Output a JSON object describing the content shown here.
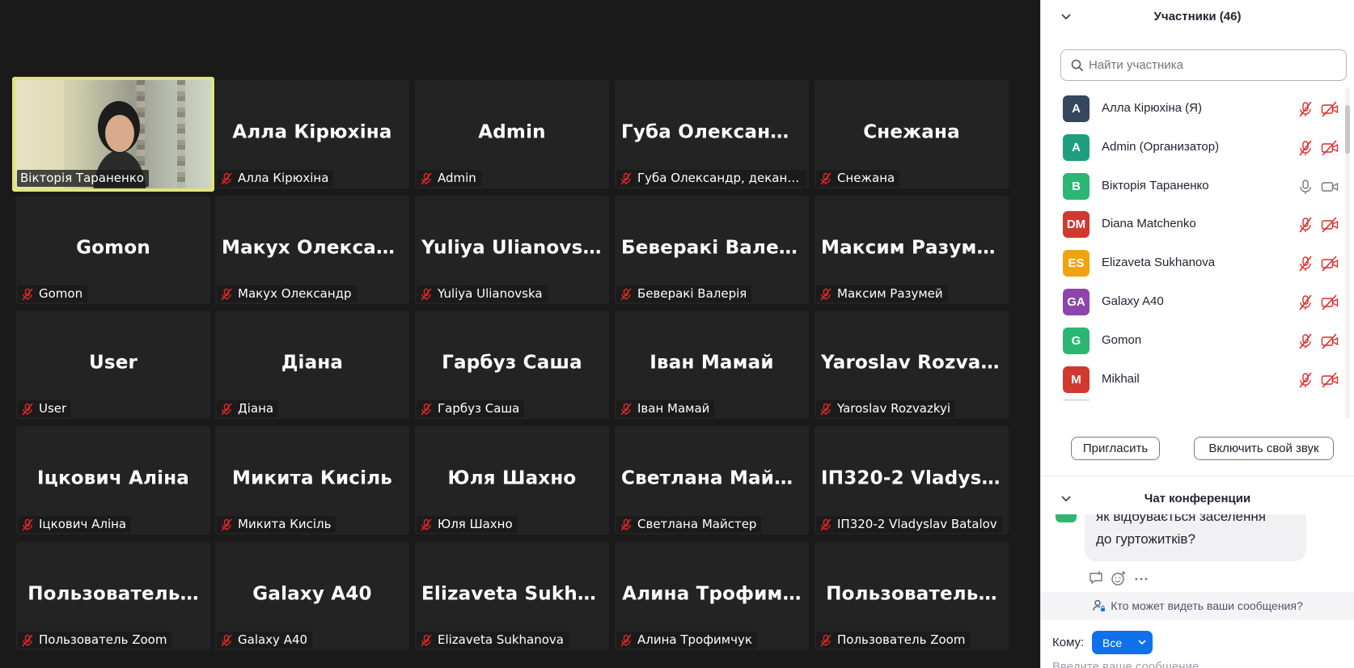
{
  "grid": {
    "tiles": [
      {
        "big": "",
        "label": "Вікторія Тараненко",
        "speaker": true,
        "video": true
      },
      {
        "big": "Алла Кірюхіна",
        "label": "Алла Кірюхіна"
      },
      {
        "big": "Admin",
        "label": "Admin"
      },
      {
        "big": "Губа  Олександ…",
        "label": "Губа Олександр, декан фак…"
      },
      {
        "big": "Снежана",
        "label": "Снежана"
      },
      {
        "big": "Gomon",
        "label": "Gomon"
      },
      {
        "big": "Макух  Олексан…",
        "label": "Макух Олександр"
      },
      {
        "big": "Yuliya Ulianovska",
        "label": "Yuliya Ulianovska"
      },
      {
        "big": "Беверакі Валерія",
        "label": "Беверакі Валерія"
      },
      {
        "big": "Максим Разумей",
        "label": "Максим Разумей"
      },
      {
        "big": "User",
        "label": "User"
      },
      {
        "big": "Діана",
        "label": "Діана"
      },
      {
        "big": "Гарбуз Саша",
        "label": "Гарбуз Саша"
      },
      {
        "big": "Іван Мамай",
        "label": "Іван Мамай"
      },
      {
        "big": "Yaroslav  Rozvaz…",
        "label": "Yaroslav Rozvazkyi"
      },
      {
        "big": "Іцкович Аліна",
        "label": "Іцкович Аліна"
      },
      {
        "big": "Микита Кисіль",
        "label": "Микита Кисіль"
      },
      {
        "big": "Юля Шахно",
        "label": "Юля Шахно"
      },
      {
        "big": "Светлана  Майс…",
        "label": "Светлана Майстер"
      },
      {
        "big": "ІП320-2  Vladysl…",
        "label": "ІП320-2 Vladyslav Batalov"
      },
      {
        "big": "Пользователь…",
        "label": "Пользователь Zoom"
      },
      {
        "big": "Galaxy A40",
        "label": "Galaxy A40"
      },
      {
        "big": "Elizaveta  Sukha…",
        "label": "Elizaveta Sukhanova"
      },
      {
        "big": "Алина  Трофим…",
        "label": "Алина Трофимчук"
      },
      {
        "big": "Пользователь…",
        "label": "Пользователь Zoom"
      }
    ]
  },
  "participants": {
    "title": "Участники (46)",
    "search_placeholder": "Найти участника",
    "list": [
      {
        "initials": "А",
        "name": "Алла Кірюхіна (Я)",
        "color": "#36465d",
        "muted": true,
        "cam_off": true
      },
      {
        "initials": "A",
        "name": "Admin (Организатор)",
        "color": "#1e9e7e",
        "muted": true,
        "cam_off": true
      },
      {
        "initials": "В",
        "name": "Вікторія Тараненко",
        "color": "#2bb673",
        "muted": false,
        "cam_off": false
      },
      {
        "initials": "DM",
        "name": "Diana Matchenko",
        "color": "#d0392f",
        "muted": true,
        "cam_off": true
      },
      {
        "initials": "ES",
        "name": "Elizaveta Sukhanova",
        "color": "#f0a30f",
        "muted": true,
        "cam_off": true
      },
      {
        "initials": "GA",
        "name": "Galaxy A40",
        "color": "#8e44ad",
        "muted": true,
        "cam_off": true
      },
      {
        "initials": "G",
        "name": "Gomon",
        "color": "#2bb673",
        "muted": true,
        "cam_off": true
      },
      {
        "initials": "M",
        "name": "Mikhail",
        "color": "#d0392f",
        "muted": true,
        "cam_off": true
      }
    ],
    "invite_label": "Пригласить",
    "unmute_label": "Включить свой звук"
  },
  "chat": {
    "title": "Чат конференции",
    "message_line1": "як відбувається заселення",
    "message_line2": "до гуртожитків?",
    "privacy_label": "Кто может видеть ваши сообщения?",
    "to_label": "Кому:",
    "to_value": "Все",
    "compose_placeholder": "Введите ваше сообщение..."
  },
  "colors": {
    "speaker_border": "#dfe57a",
    "mute_red": "#e02828",
    "accent_blue": "#0e71eb"
  }
}
